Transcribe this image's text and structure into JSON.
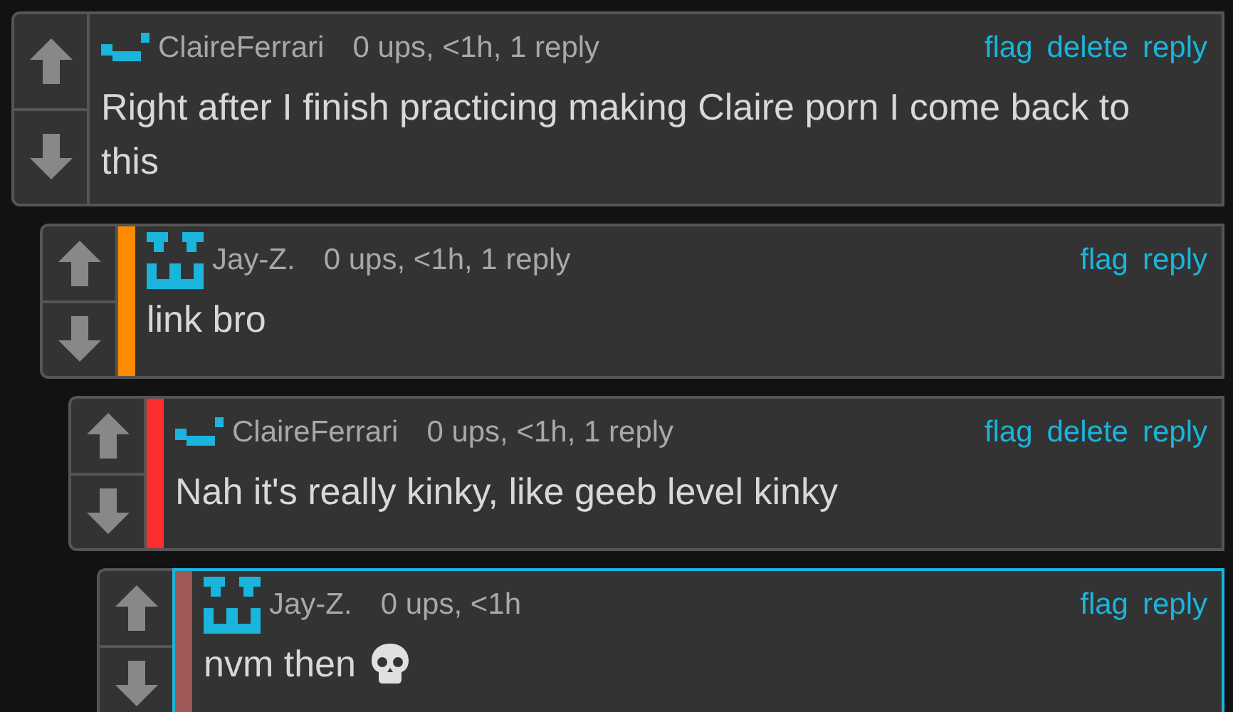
{
  "comments": [
    {
      "author": "ClaireFerrari",
      "kind": "smirk",
      "meta": "0 ups, <1h, 1 reply",
      "actions": [
        "flag",
        "delete",
        "reply"
      ],
      "text": "Right after I finish practicing making Claire porn I come back to this",
      "emoji": false,
      "highlighted": false,
      "children": [
        {
          "author": "Jay-Z.",
          "kind": "grin",
          "meta": "0 ups, <1h, 1 reply",
          "actions": [
            "flag",
            "reply"
          ],
          "text": "link bro",
          "emoji": false,
          "color": "#ff8c00",
          "highlighted": false,
          "children": [
            {
              "author": "ClaireFerrari",
              "kind": "smirk",
              "meta": "0 ups, <1h, 1 reply",
              "actions": [
                "flag",
                "delete",
                "reply"
              ],
              "text": "Nah it's really kinky, like geeb level kinky",
              "emoji": false,
              "color": "#ff2e2e",
              "highlighted": false,
              "children": [
                {
                  "author": "Jay-Z.",
                  "kind": "grin",
                  "meta": "0 ups, <1h",
                  "actions": [
                    "flag",
                    "reply"
                  ],
                  "text": "nvm then",
                  "emoji": true,
                  "color": "#a05858",
                  "highlighted": true
                }
              ]
            }
          ]
        }
      ]
    }
  ]
}
